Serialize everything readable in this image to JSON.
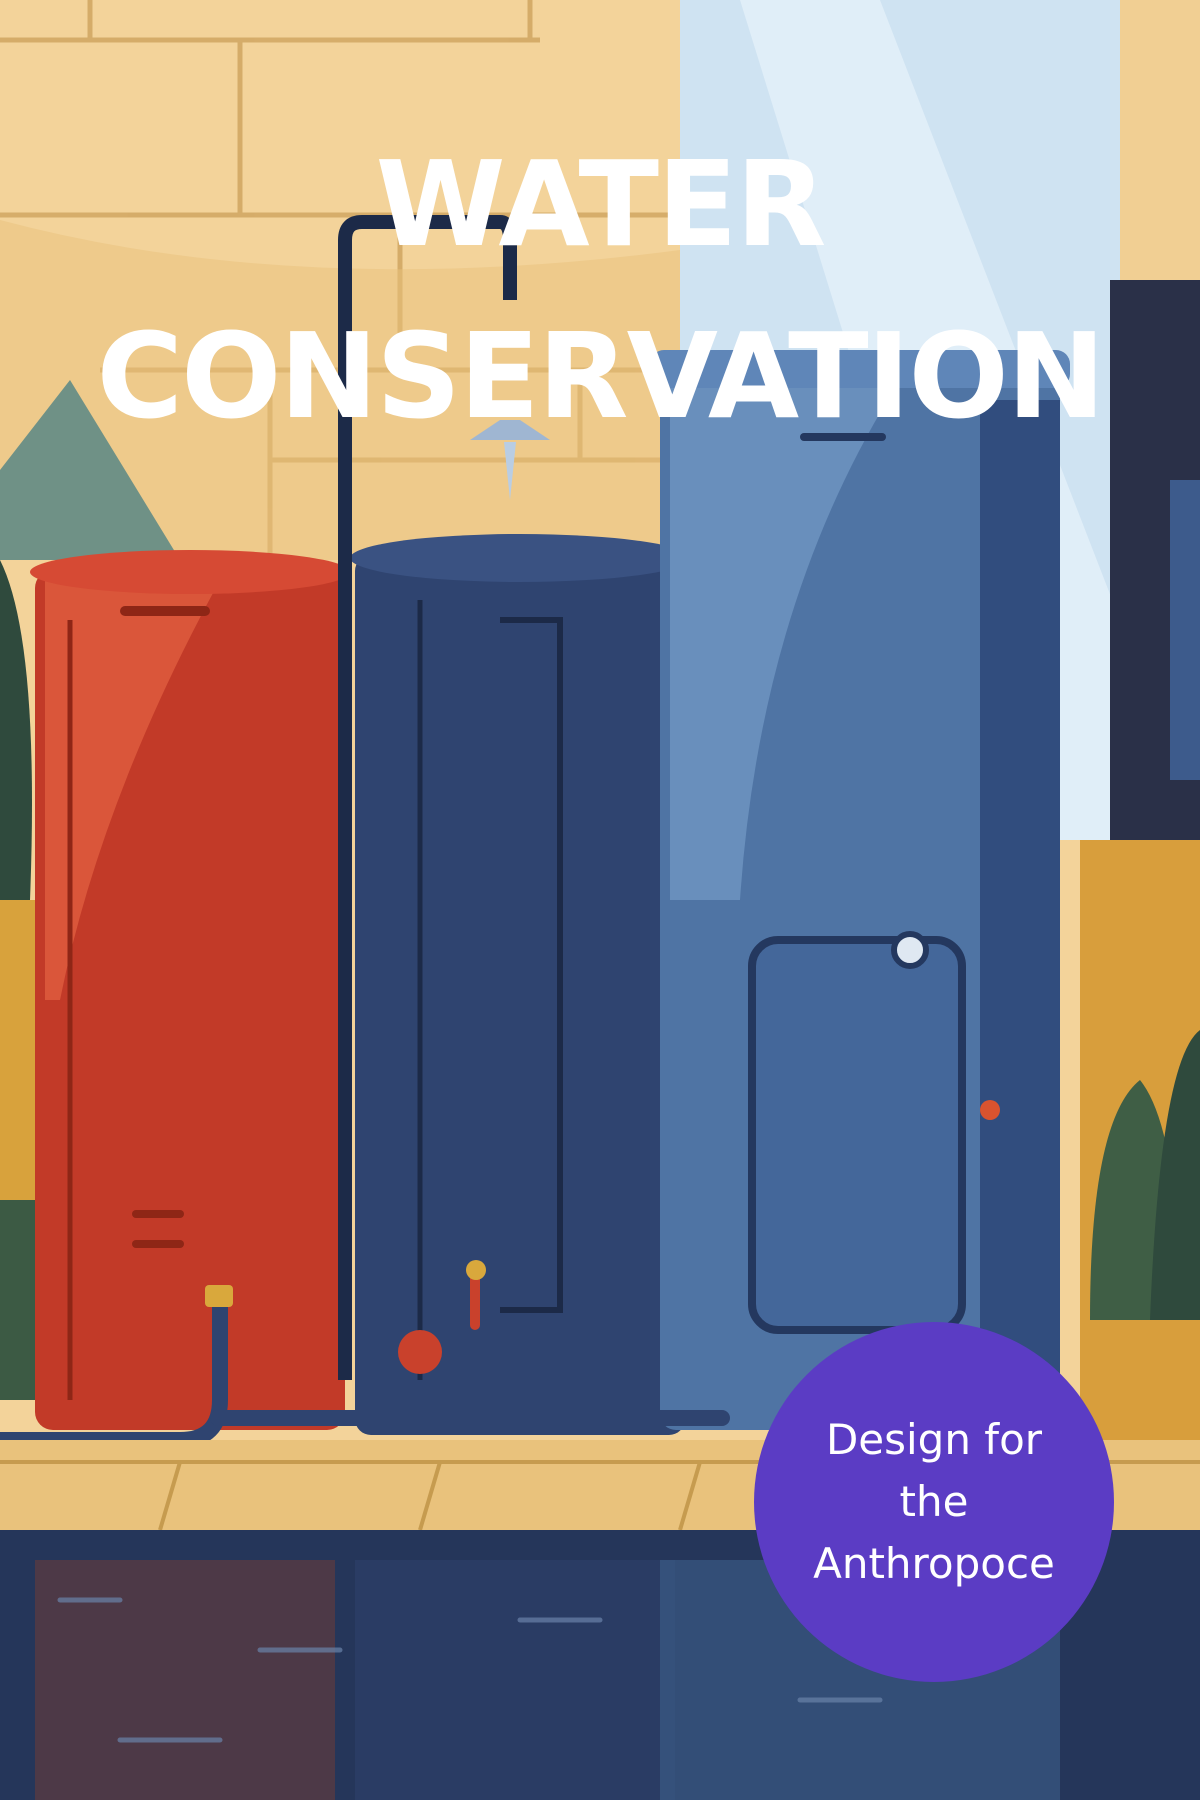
{
  "title": {
    "line1": "WATER",
    "line2": "CONSERVATION"
  },
  "badge": {
    "line1": "Design for",
    "line2": "the",
    "line3": "Anthropoce"
  },
  "colors": {
    "wall": "#f3d39a",
    "sky": "#cfe3f2",
    "red_tank": "#c9412c",
    "navy_tank": "#2f4470",
    "blue_tank": "#4f74a4",
    "badge": "#5b3cc4",
    "water": "#25365a",
    "deck": "#e9c27c"
  }
}
